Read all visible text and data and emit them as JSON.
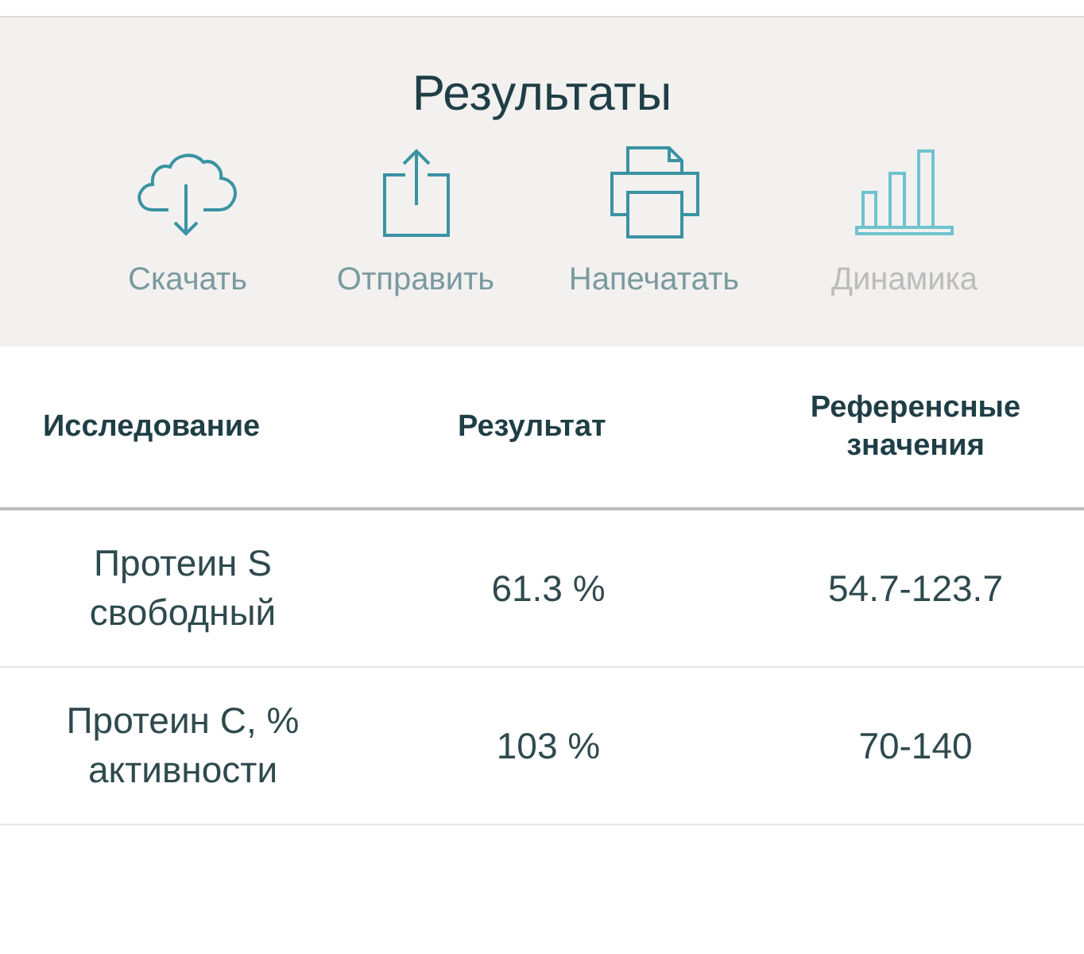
{
  "header": {
    "title": "Результаты"
  },
  "actions": [
    {
      "kind": "download",
      "label": "Скачать",
      "disabled": false
    },
    {
      "kind": "share",
      "label": "Отправить",
      "disabled": false
    },
    {
      "kind": "print",
      "label": "Напечатать",
      "disabled": false
    },
    {
      "kind": "chart",
      "label": "Динамика",
      "disabled": true
    }
  ],
  "table": {
    "columns": [
      "Исследование",
      "Результат",
      "Референсные значения"
    ],
    "rows": [
      [
        "Протеин S свободный",
        "61.3 %",
        "54.7-123.7"
      ],
      [
        "Протеин С, % активности",
        "103 %",
        "70-140"
      ]
    ]
  }
}
